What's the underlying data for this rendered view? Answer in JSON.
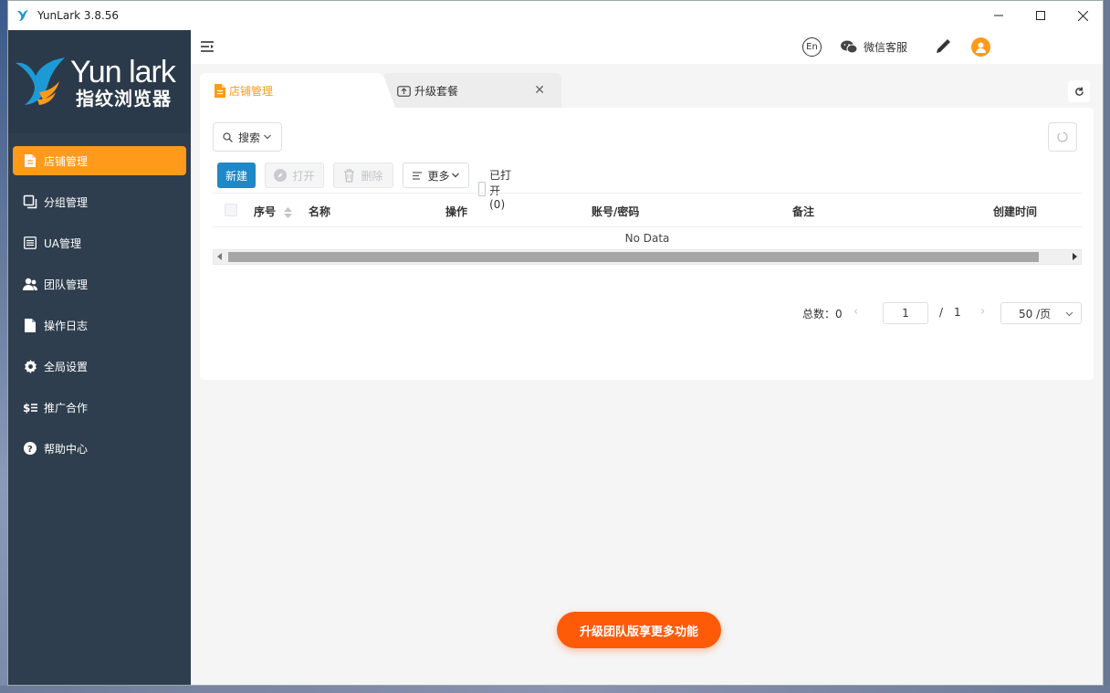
{
  "window": {
    "title": "YunLark 3.8.56"
  },
  "logo": {
    "brand": "Yun lark",
    "subtitle": "指纹浏览器"
  },
  "sidebar": {
    "items": [
      {
        "label": "店铺管理",
        "icon": "file-icon",
        "active": true
      },
      {
        "label": "分组管理",
        "icon": "copy-icon"
      },
      {
        "label": "UA管理",
        "icon": "list-icon"
      },
      {
        "label": "团队管理",
        "icon": "users-icon"
      },
      {
        "label": "操作日志",
        "icon": "doc-icon"
      },
      {
        "label": "全局设置",
        "icon": "gear-icon"
      },
      {
        "label": "推广合作",
        "icon": "dollar-icon"
      },
      {
        "label": "帮助中心",
        "icon": "help-icon"
      }
    ]
  },
  "header": {
    "lang": "En",
    "wechat_service": "微信客服"
  },
  "tabs": [
    {
      "label": "店铺管理",
      "active": true
    },
    {
      "label": "升级套餐"
    }
  ],
  "toolbar": {
    "search": "搜索",
    "new": "新建",
    "open": "打开",
    "delete": "删除",
    "more": "更多",
    "opened": "已打开 (0)"
  },
  "table": {
    "columns": [
      "序号",
      "名称",
      "操作",
      "账号/密码",
      "备注",
      "创建时间"
    ],
    "empty_text": "No Data"
  },
  "pagination": {
    "total_label": "总数",
    "total_value": "总数：0",
    "current_page": "1",
    "slash": "/",
    "total_pages": "1",
    "page_size": "50 /页"
  },
  "upgrade_button": "升级团队版享更多功能",
  "colors": {
    "accent": "#ff9a1a",
    "primary": "#1e88c8",
    "sidebar": "#2f3e4e",
    "cta": "#ff5a08"
  }
}
